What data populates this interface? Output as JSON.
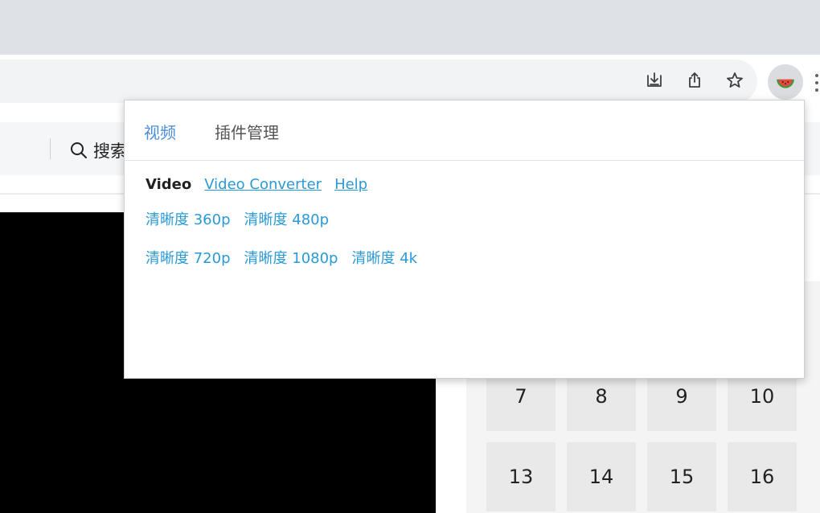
{
  "popup": {
    "tabs": [
      {
        "label": "视频",
        "active": true
      },
      {
        "label": "插件管理",
        "active": false
      }
    ],
    "nav": {
      "title": "Video",
      "links": [
        "Video Converter",
        "Help"
      ]
    },
    "quality_rows": [
      [
        "清晰度 360p",
        "清晰度 480p"
      ],
      [
        "清晰度 720p",
        "清晰度 1080p",
        "清晰度 4k"
      ]
    ]
  },
  "page": {
    "search_label": "搜索",
    "grid_numbers": [
      "7",
      "8",
      "9",
      "10",
      "13",
      "14",
      "15",
      "16"
    ]
  },
  "colors": {
    "accent_tab": "#4a8fd9",
    "link": "#2a9ad6"
  },
  "icons": {
    "toolbar": [
      "download-icon",
      "share-icon",
      "star-icon",
      "watermelon-extension-icon",
      "menu-dots-icon"
    ]
  }
}
